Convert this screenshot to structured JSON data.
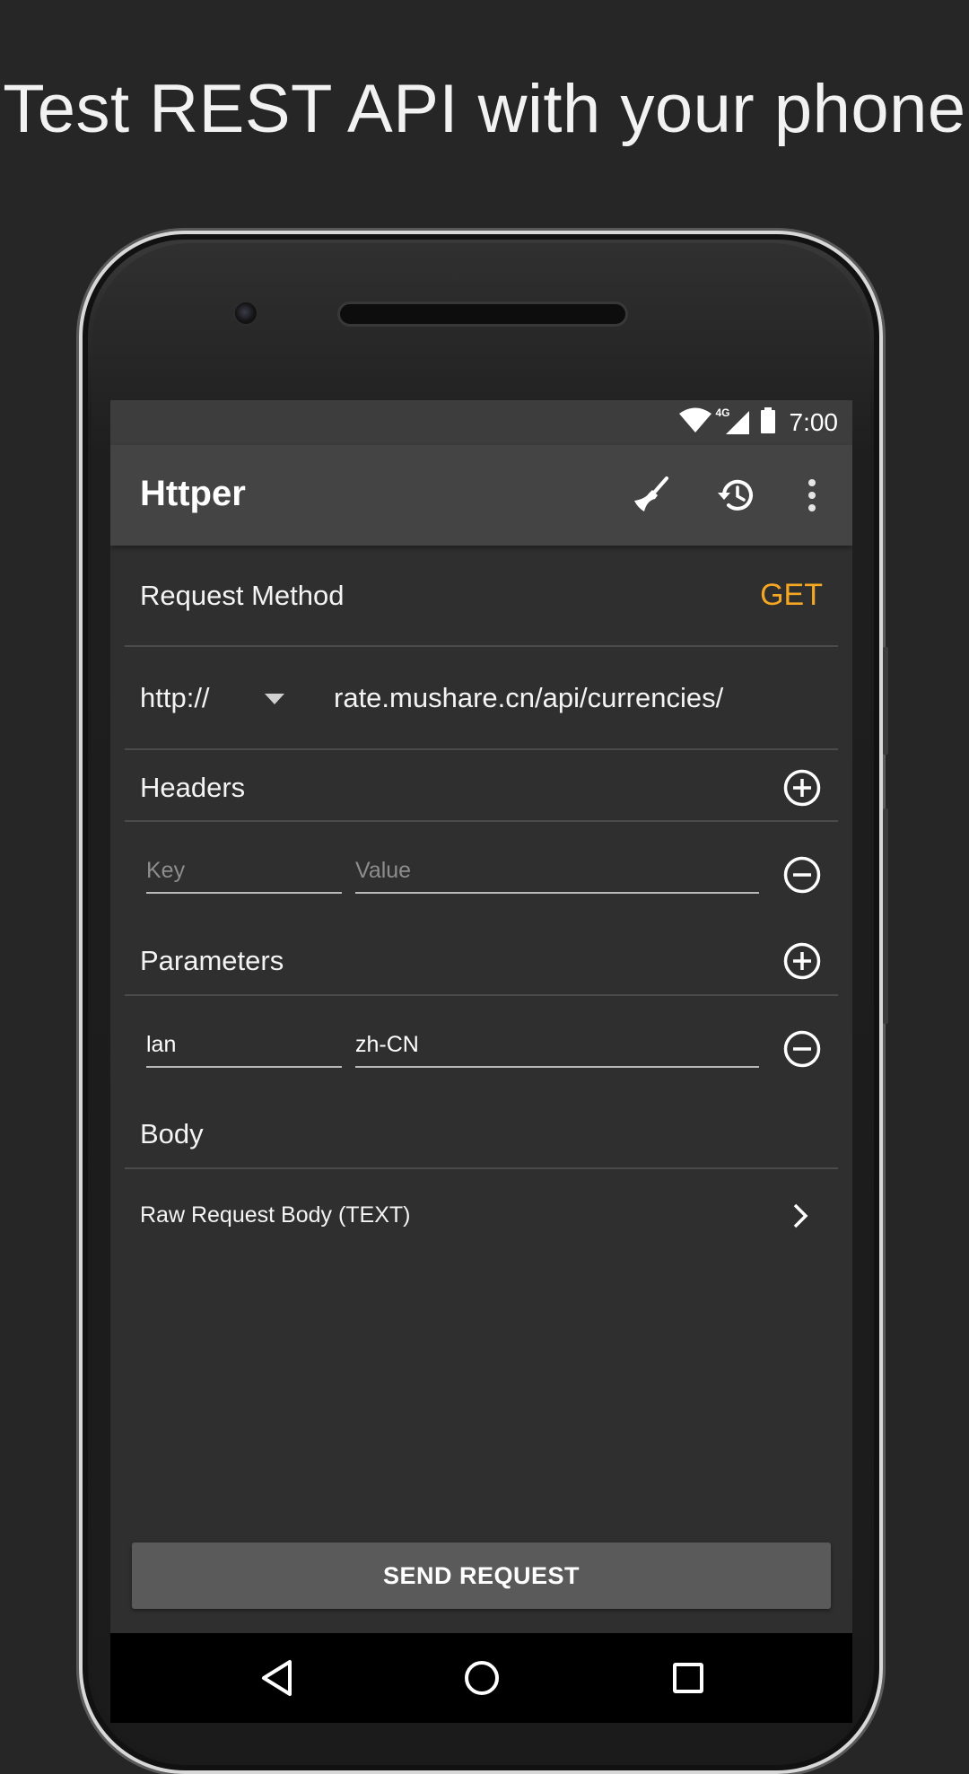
{
  "promo": {
    "headline": "Test REST API with your phone"
  },
  "status_bar": {
    "network_label": "4G",
    "time": "7:00",
    "icons": [
      "wifi-icon",
      "cell-signal-icon",
      "battery-icon"
    ]
  },
  "app_bar": {
    "title": "Httper",
    "actions": [
      {
        "name": "clear-broom-icon",
        "label": "Clear"
      },
      {
        "name": "history-icon",
        "label": "History"
      },
      {
        "name": "overflow-menu-icon",
        "label": "More options"
      }
    ]
  },
  "request_method": {
    "label": "Request Method",
    "value": "GET"
  },
  "url": {
    "protocol": "http://",
    "address": "rate.mushare.cn/api/currencies/"
  },
  "headers": {
    "label": "Headers",
    "rows": [
      {
        "key": "",
        "value": "",
        "key_placeholder": "Key",
        "value_placeholder": "Value"
      }
    ]
  },
  "parameters": {
    "label": "Parameters",
    "rows": [
      {
        "key": "lan",
        "value": "zh-CN"
      }
    ]
  },
  "body": {
    "label": "Body",
    "item": "Raw Request Body (TEXT)"
  },
  "send_button": {
    "label": "SEND REQUEST"
  },
  "nav": {
    "items": [
      "back-icon",
      "home-icon",
      "recents-icon"
    ]
  },
  "colors": {
    "accent": "#f5a623",
    "background": "#262626",
    "screen": "#2f2f2f",
    "app_bar": "#444444"
  }
}
